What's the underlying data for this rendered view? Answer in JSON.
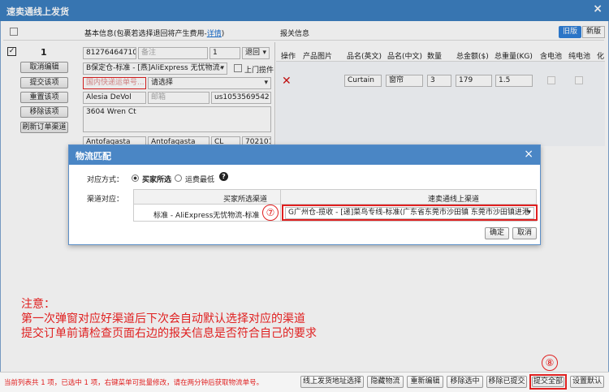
{
  "window": {
    "title": "速卖通线上发货",
    "close_icon": "×"
  },
  "header": {
    "basic_info": "基本信息(包裹若选择退回将产生费用-",
    "detail_link": "详情",
    "basic_info_tail": ")",
    "customs_info": "报关信息",
    "old_version": "旧版",
    "new_version": "新版"
  },
  "order": {
    "index": "1",
    "order_no": "8127646471033C",
    "remark_placeholder": "备注",
    "qty": "1",
    "return_option": "退回",
    "channel": "B保定仓-标准 - [燕]AliExpress 无忧物流-",
    "pickup_label": "上门揽件",
    "tracking_placeholder": "国内快递运单号...",
    "please_select": "请选择",
    "name": "Alesia DeVol",
    "zip_placeholder": "邮箱",
    "phone": "us1053569542",
    "address": "3604 Wren Ct",
    "city1": "Antofagasta",
    "city2": "Antofagasta",
    "country": "CL",
    "postcode": "702101",
    "buttons": [
      "取消编辑",
      "提交该项",
      "重置该项",
      "移除该项",
      "刷新订单渠道"
    ]
  },
  "customs": {
    "columns": [
      "操作",
      "产品图片",
      "品名(英文)",
      "品名(中文)",
      "数量",
      "总金额($)",
      "总重量(KG)",
      "含电池",
      "纯电池",
      "化"
    ],
    "row": {
      "name_en": "Curtain",
      "name_cn": "窗帘",
      "qty": "3",
      "amount": "179",
      "weight": "1.5"
    }
  },
  "dialog": {
    "title": "物流匹配",
    "match_label": "对应方式：",
    "opt_buyer": "买家所选",
    "opt_cheapest": "运费最低",
    "channel_label": "渠道对应：",
    "col_buyer": "买家所选渠道",
    "col_online": "速卖通线上渠道",
    "buyer_channel": "标准 - AliExpress无忧物流-标准",
    "online_channel": "G广州仓-揽收 - [递]菜鸟专线-标准(广东省东莞市沙田镇 东莞市沙田镇进港",
    "marker7": "⑦",
    "ok": "确定",
    "cancel": "取消"
  },
  "note": {
    "line1": "注意：",
    "line2": "第一次弹窗对应好渠道后下次会自动默认选择对应的渠道",
    "line3": "提交订单前请检查页面右边的报关信息是否符合自己的要求"
  },
  "marker8": "⑧",
  "bottom": {
    "status": "当前列表共 1 项，已选中 1 项，右键菜单可批量修改，请在两分钟后获取物流单号。",
    "buttons": [
      "线上发货地址选择",
      "隐藏物流",
      "重新编辑",
      "移除选中",
      "移除已提交",
      "提交全部",
      "设置默认"
    ]
  },
  "colors": {
    "accent": "#3c7fc1",
    "highlight": "#e02020"
  }
}
